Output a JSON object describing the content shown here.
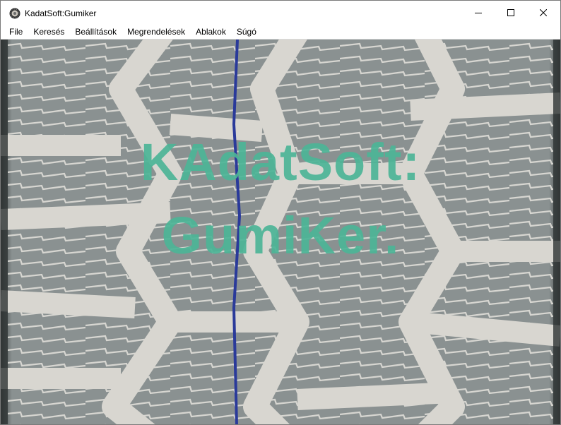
{
  "window": {
    "title": "KadatSoft:Gumiker",
    "app_icon": "tire-icon",
    "controls": [
      "minimize-icon",
      "maximize-icon",
      "close-icon"
    ]
  },
  "menu": {
    "items": [
      {
        "label": "File"
      },
      {
        "label": "Keresés"
      },
      {
        "label": "Beállítások"
      },
      {
        "label": "Megrendelések"
      },
      {
        "label": "Ablakok"
      },
      {
        "label": "Súgó"
      }
    ]
  },
  "splash": {
    "line1": "KAdatSoft:",
    "line2": "GumiKer.",
    "color": "#4db597"
  },
  "background": {
    "image": "tire-tread-photo",
    "tread_color": "#d8d6d0",
    "groove_color": "#7f8686",
    "stripe_color": "#2a3a9a"
  }
}
